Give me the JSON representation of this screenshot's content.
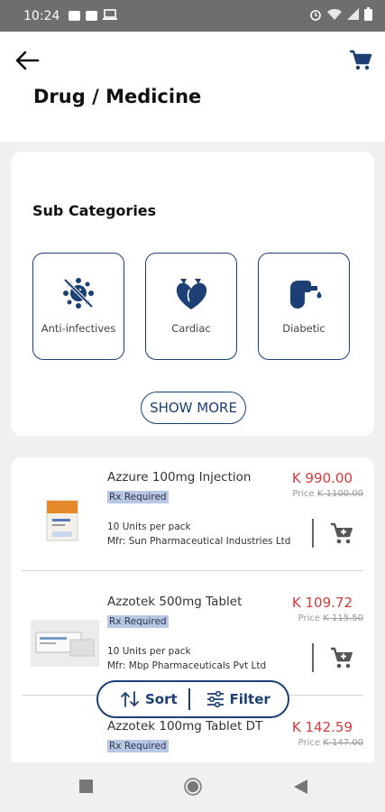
{
  "status_bar": {
    "time": "10:24",
    "icons": [
      "image-icon",
      "image-icon",
      "laptop-icon",
      "alarm-icon",
      "wifi-icon",
      "signal-icon",
      "battery-icon"
    ]
  },
  "header": {
    "title": "Drug / Medicine",
    "back_icon": "arrow-left-icon",
    "cart_icon": "cart-icon"
  },
  "subcategories": {
    "title": "Sub Categories",
    "items": [
      {
        "label": "Anti-infectives",
        "icon": "virus-icon"
      },
      {
        "label": "Cardiac",
        "icon": "heart-icon"
      },
      {
        "label": "Diabetic",
        "icon": "glucose-meter-icon"
      }
    ],
    "show_more": "SHOW MORE"
  },
  "products": [
    {
      "name": "Azzure 100mg Injection",
      "rx": "Rx Required",
      "price": "K 990.00",
      "mrp_label": "Price",
      "mrp_value": "K 1100.00",
      "units": "10 Units per pack",
      "mfr": "Mfr: Sun Pharmaceutical Industries Ltd"
    },
    {
      "name": "Azzotek 500mg Tablet",
      "rx": "Rx Required",
      "price": "K 109.72",
      "mrp_label": "Price",
      "mrp_value": "K 115.50",
      "units": "10 Units per pack",
      "mfr": "Mfr: Mbp Pharmaceuticals Pvt Ltd"
    },
    {
      "name": "Azzotek 100mg Tablet DT",
      "rx": "Rx Required",
      "price": "K 142.59",
      "mrp_label": "Price",
      "mrp_value": "K 147.00"
    }
  ],
  "sort_filter": {
    "sort": "Sort",
    "filter": "Filter"
  },
  "colors": {
    "accent": "#1c3f75",
    "price": "#d63a3a",
    "rx_badge": "#b7c7e6"
  }
}
